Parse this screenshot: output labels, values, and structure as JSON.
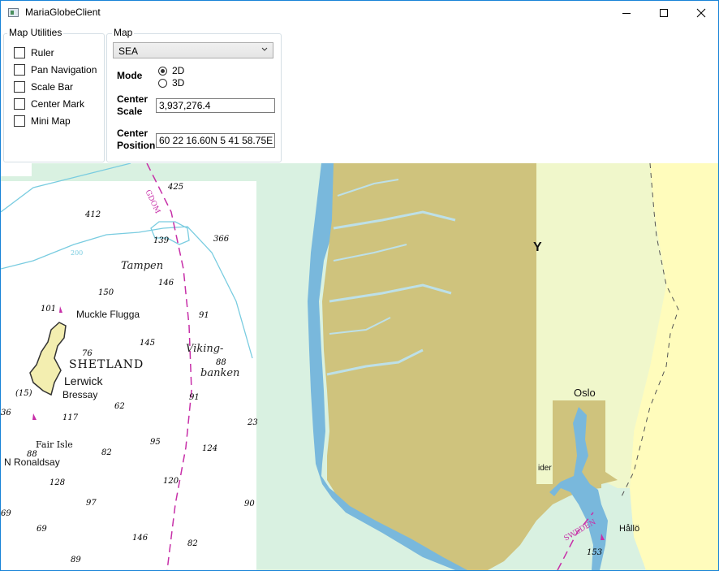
{
  "window": {
    "title": "MariaGlobeClient"
  },
  "map_utilities": {
    "title": "Map Utilities",
    "items": [
      {
        "label": "Ruler",
        "checked": false
      },
      {
        "label": "Pan Navigation",
        "checked": false
      },
      {
        "label": "Scale Bar",
        "checked": false
      },
      {
        "label": "Center Mark",
        "checked": false
      },
      {
        "label": "Mini Map",
        "checked": false
      }
    ]
  },
  "map_panel": {
    "title": "Map",
    "layer_selected": "SEA",
    "mode_label": "Mode",
    "mode_options": [
      {
        "label": "2D",
        "selected": true
      },
      {
        "label": "3D",
        "selected": false
      }
    ],
    "center_scale_label_1": "Center",
    "center_scale_label_2": "Scale",
    "center_scale_value": "3,937,276.4",
    "center_position_label_1": "Center",
    "center_position_label_2": "Position",
    "center_position_value": "60 22 16.60N 5 41 58.75E"
  },
  "chart_labels": {
    "places": [
      "Tampen",
      "Muckle Flugga",
      "SHETLAND",
      "Lerwick",
      "Bressay",
      "Fair Isle",
      "N Ronaldsay",
      "Viking-",
      "banken",
      "Oslo",
      "Hållö",
      "SWEDEN",
      "GDOM",
      "200",
      "Y",
      "ider"
    ],
    "depths": [
      "425",
      "412",
      "139",
      "366",
      "146",
      "150",
      "101",
      "91",
      "145",
      "76",
      "88",
      "(15)",
      "91",
      "36",
      "62",
      "117",
      "88",
      "82",
      "95",
      "124",
      "23",
      "128",
      "120",
      "90",
      "97",
      "69",
      "69",
      "146",
      "82",
      "89",
      "153"
    ]
  },
  "colors": {
    "sea": "#ffffff",
    "shallow": "#d9f1e1",
    "land": "#cfc37d",
    "water": "#79b8dc",
    "neighbor_land": "#fffcbc",
    "route": "#c72fa8",
    "accent": "#1883d7"
  }
}
